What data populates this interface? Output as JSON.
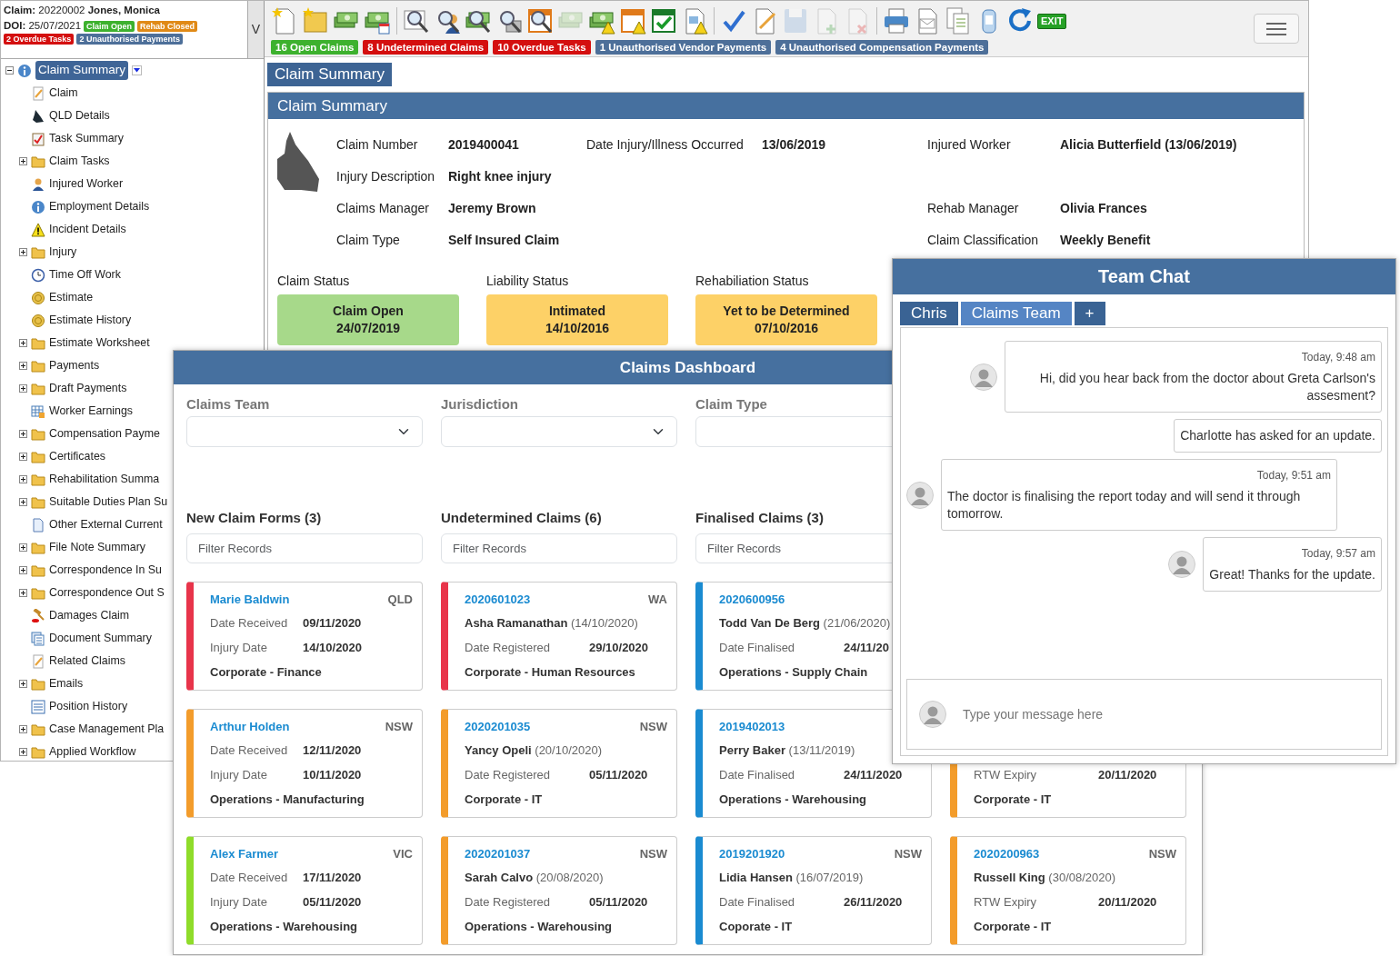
{
  "sidebar": {
    "claim_line": "**Claim:** 20220002 **Jones, Monica**",
    "doi_line": "**DOI:** 25/07/2021",
    "status_badges": [
      {
        "text": "Claim Open",
        "color": "#3db12e"
      },
      {
        "text": "Rehab Closed",
        "color": "#e08a17"
      }
    ],
    "alert_badges": [
      {
        "text": "2 Overdue Tasks",
        "color": "#d40f0f"
      },
      {
        "text": "2 Unauthorised Payments",
        "color": "#4d6f99"
      }
    ],
    "toggle": "V",
    "tree": [
      {
        "label": "Claim Summary",
        "kind": "info",
        "selected": true,
        "expanded": true,
        "children": [
          {
            "label": "Claim",
            "kind": "note",
            "selected": false
          },
          {
            "label": "QLD Details",
            "kind": "map",
            "selected": false
          },
          {
            "label": "Task Summary",
            "kind": "clipboard",
            "selected": false
          },
          {
            "label": "Claim Tasks",
            "kind": "folder",
            "selected": false,
            "expanded": false
          },
          {
            "label": "Injured Worker",
            "kind": "person",
            "selected": false
          },
          {
            "label": "Employment Details",
            "kind": "info",
            "selected": false
          },
          {
            "label": "Incident Details",
            "kind": "warning",
            "selected": false
          },
          {
            "label": "Injury",
            "kind": "folder",
            "selected": false,
            "expanded": false
          },
          {
            "label": "Time Off Work",
            "kind": "clock",
            "selected": false
          },
          {
            "label": "Estimate",
            "kind": "coin",
            "selected": false
          },
          {
            "label": "Estimate History",
            "kind": "coin",
            "selected": false
          },
          {
            "label": "Estimate Worksheet",
            "kind": "folder",
            "selected": false,
            "expanded": false
          },
          {
            "label": "Payments",
            "kind": "folder",
            "selected": false,
            "expanded": false
          },
          {
            "label": "Draft Payments",
            "kind": "folder",
            "selected": false,
            "expanded": false
          },
          {
            "label": "Worker Earnings",
            "kind": "table",
            "selected": false
          },
          {
            "label": "Compensation Payme",
            "kind": "folder",
            "selected": false,
            "expanded": false
          },
          {
            "label": "Certificates",
            "kind": "folder",
            "selected": false,
            "expanded": false
          },
          {
            "label": "Rehabilitation Summa",
            "kind": "folder",
            "selected": false,
            "expanded": false
          },
          {
            "label": "Suitable Duties Plan Su",
            "kind": "folder",
            "selected": false,
            "expanded": false
          },
          {
            "label": "Other External Current",
            "kind": "page",
            "selected": false
          },
          {
            "label": "File Note Summary",
            "kind": "folder",
            "selected": false,
            "expanded": false
          },
          {
            "label": "Correspondence In Su",
            "kind": "folder",
            "selected": false,
            "expanded": false
          },
          {
            "label": "Correspondence Out S",
            "kind": "folder",
            "selected": false,
            "expanded": false
          },
          {
            "label": "Damages Claim",
            "kind": "gavel",
            "selected": false
          },
          {
            "label": "Document Summary",
            "kind": "documents",
            "selected": false
          },
          {
            "label": "Related Claims",
            "kind": "note",
            "selected": false
          },
          {
            "label": "Emails",
            "kind": "folder",
            "selected": false,
            "expanded": false
          },
          {
            "label": "Position History",
            "kind": "list",
            "selected": false
          },
          {
            "label": "Case Management Pla",
            "kind": "folder",
            "selected": false,
            "expanded": false
          },
          {
            "label": "Applied Workflow",
            "kind": "folder",
            "selected": false,
            "expanded": false
          }
        ]
      }
    ]
  },
  "toolbar": {
    "items": [
      {
        "kind": "document",
        "disabled": false
      },
      {
        "kind": "folder",
        "disabled": false
      },
      {
        "kind": "cash",
        "disabled": false
      },
      {
        "kind": "cash-calendar",
        "disabled": false
      },
      {
        "kind": "separator"
      },
      {
        "kind": "document-search",
        "disabled": false
      },
      {
        "kind": "person-search",
        "disabled": false
      },
      {
        "kind": "cash-search",
        "disabled": false
      },
      {
        "kind": "search",
        "disabled": false
      },
      {
        "kind": "calendar-search",
        "disabled": false
      },
      {
        "kind": "cash",
        "disabled": true
      },
      {
        "kind": "cash-warning",
        "disabled": false
      },
      {
        "kind": "calendar-warning",
        "disabled": false
      },
      {
        "kind": "calendar-check",
        "disabled": false
      },
      {
        "kind": "document-warning",
        "disabled": false
      },
      {
        "kind": "separator"
      },
      {
        "kind": "check",
        "disabled": false
      },
      {
        "kind": "notepad",
        "disabled": false
      },
      {
        "kind": "save",
        "disabled": true
      },
      {
        "kind": "add-document",
        "disabled": true
      },
      {
        "kind": "delete-document",
        "disabled": true
      },
      {
        "kind": "separator"
      },
      {
        "kind": "printer",
        "disabled": false
      },
      {
        "kind": "envelope",
        "disabled": false
      },
      {
        "kind": "documents",
        "disabled": false
      },
      {
        "kind": "jar",
        "disabled": false
      },
      {
        "kind": "refresh",
        "disabled": false
      },
      {
        "kind": "exit",
        "label": "EXIT",
        "disabled": false
      }
    ],
    "badges": [
      {
        "text": "16 Open Claims",
        "color": "#3db12e"
      },
      {
        "text": "8 Undetermined Claims",
        "color": "#d40f0f"
      },
      {
        "text": "10 Overdue Tasks",
        "color": "#d40f0f"
      },
      {
        "text": "1 Unauthorised Vendor Payments",
        "color": "#4d6f99"
      },
      {
        "text": "4 Unauthorised Compensation Payments",
        "color": "#4d6f99"
      }
    ]
  },
  "page_tab": "Claim Summary",
  "claim_summary": {
    "title": "Claim Summary",
    "details": [
      {
        "left": {
          "label": "Claim Number",
          "value": "2019400041"
        },
        "middle": {
          "label": "Date Injury/Illness Occurred",
          "value": "13/06/2019"
        },
        "right": {
          "label": "Injured Worker",
          "value": "Alicia Butterfield (13/06/2019)"
        }
      },
      {
        "left": {
          "label": "Injury Description",
          "value": "Right knee injury"
        }
      },
      {
        "left": {
          "label": "Claims Manager",
          "value": "Jeremy Brown"
        },
        "right": {
          "label": "Rehab Manager",
          "value": "Olivia Frances"
        }
      },
      {
        "left": {
          "label": "Claim Type",
          "value": "Self Insured Claim"
        },
        "right": {
          "label": "Claim Classification",
          "value": "Weekly Benefit"
        }
      }
    ],
    "statuses": [
      {
        "label": "Claim Status",
        "status": "Claim Open",
        "date": "24/07/2019",
        "color": "#a7d98a"
      },
      {
        "label": "Liability Status",
        "status": "Intimated",
        "date": "14/10/2016",
        "color": "#fdd167"
      },
      {
        "label": "Rehabiliation Status",
        "status": "Yet to be Determined",
        "date": "07/10/2016",
        "color": "#fdd167"
      }
    ]
  },
  "dashboard": {
    "title": "Claims Dashboard",
    "filters": [
      {
        "label": "Claims Team"
      },
      {
        "label": "Jurisdiction"
      },
      {
        "label": "Claim Type"
      }
    ],
    "columns": [
      {
        "title": "New Claim Forms (3)",
        "filter_placeholder": "Filter Records",
        "cards": [
          {
            "color": "#e8344a",
            "title": "Marie Baldwin",
            "region": "QLD",
            "fields": [
              {
                "label": "Date Received",
                "value": "09/11/2020"
              },
              {
                "label": "Injury Date",
                "value": "14/10/2020"
              }
            ],
            "department": "Corporate - Finance"
          },
          {
            "color": "#f39c2b",
            "title": "Arthur Holden",
            "region": "NSW",
            "fields": [
              {
                "label": "Date Received",
                "value": "12/11/2020"
              },
              {
                "label": "Injury Date",
                "value": "10/11/2020"
              }
            ],
            "department": "Operations - Manufacturing"
          },
          {
            "color": "#8fdc2a",
            "title": "Alex Farmer",
            "region": "VIC",
            "fields": [
              {
                "label": "Date Received",
                "value": "17/11/2020"
              },
              {
                "label": "Injury Date",
                "value": "05/11/2020"
              }
            ],
            "department": "Operations - Warehousing"
          }
        ]
      },
      {
        "title": "Undetermined Claims (6)",
        "filter_placeholder": "Filter Records",
        "cards": [
          {
            "color": "#e8344a",
            "title": "2020601023",
            "region": "WA",
            "person": {
              "name": "Asha Ramanathan",
              "date": "(14/10/2020)"
            },
            "fields": [
              {
                "label": "Date Registered",
                "value": "29/10/2020"
              }
            ],
            "department": "Corporate - Human Resources"
          },
          {
            "color": "#f39c2b",
            "title": "2020201035",
            "region": "NSW",
            "person": {
              "name": "Yancy Opeli",
              "date": "(20/10/2020)"
            },
            "fields": [
              {
                "label": "Date Registered",
                "value": "05/11/2020"
              }
            ],
            "department": "Corporate - IT"
          },
          {
            "color": "#f39c2b",
            "title": "2020201037",
            "region": "NSW",
            "person": {
              "name": "Sarah Calvo",
              "date": "(20/08/2020)"
            },
            "fields": [
              {
                "label": "Date Registered",
                "value": "05/11/2020"
              }
            ],
            "department": "Operations - Warehousing"
          }
        ]
      },
      {
        "title": "Finalised Claims (3)",
        "filter_placeholder": "Filter Records",
        "cards": [
          {
            "color": "#1a8bd1",
            "title": "2020600956",
            "person": {
              "name": "Todd Van De Berg",
              "date": "(21/06/2020)"
            },
            "fields": [
              {
                "label": "Date Finalised",
                "value": "24/11/20"
              }
            ],
            "department": "Operations - Supply Chain"
          },
          {
            "color": "#1a8bd1",
            "title": "2019402013",
            "person": {
              "name": "Perry Baker",
              "date": "(13/11/2019)"
            },
            "fields": [
              {
                "label": "Date Finalised",
                "value": "24/11/2020"
              }
            ],
            "department": "Operations - Warehousing"
          },
          {
            "color": "#1a8bd1",
            "title": "2019201920",
            "region": "NSW",
            "person": {
              "name": "Lidia Hansen",
              "date": "(16/07/2019)"
            },
            "fields": [
              {
                "label": "Date Finalised",
                "value": "26/11/2020"
              }
            ],
            "department": "Coporate - IT"
          }
        ]
      },
      {
        "cards": [
          {
            "color": "#f39c2b",
            "fields": [
              {
                "label": "RTW Expiry",
                "value": "20/11/2020"
              }
            ],
            "department": "Corporate - IT"
          },
          {
            "color": "#f39c2b",
            "title": "2020200963",
            "region": "NSW",
            "person": {
              "name": "Russell King",
              "date": "(30/08/2020)"
            },
            "fields": [
              {
                "label": "RTW Expiry",
                "value": "20/11/2020"
              }
            ],
            "department": "Corporate - IT"
          }
        ]
      }
    ]
  },
  "team_chat": {
    "title": "Team Chat",
    "tabs": [
      {
        "label": "Chris",
        "selected": false
      },
      {
        "label": "Claims Team",
        "selected": true
      },
      {
        "label": "+",
        "selected": false
      }
    ],
    "messages": [
      {
        "kind": "sent",
        "avatar": true,
        "time": "Today, 9:48 am",
        "text": "Hi, did you hear back from the doctor about Greta Carlson's assesment?"
      },
      {
        "kind": "sent",
        "avatar": false,
        "text": "Charlotte has asked for an update."
      },
      {
        "kind": "received",
        "avatar": true,
        "time": "Today, 9:51 am",
        "text": "The doctor is finalising the report today and will send it through tomorrow."
      },
      {
        "kind": "sent",
        "avatar": true,
        "time": "Today, 9:57 am",
        "text": "Great! Thanks for the update."
      }
    ],
    "input_placeholder": "Type your message here"
  }
}
